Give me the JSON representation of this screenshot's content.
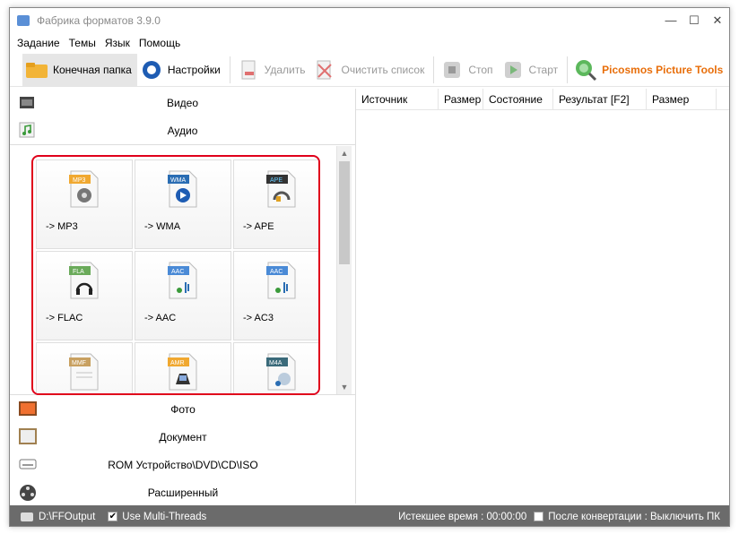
{
  "window": {
    "title": "Фабрика форматов 3.9.0",
    "controls": [
      "—",
      "☐",
      "✕"
    ]
  },
  "menu": [
    "Задание",
    "Темы",
    "Язык",
    "Помощь"
  ],
  "toolbar": {
    "output_folder": "Конечная папка",
    "settings": "Настройки",
    "remove": "Удалить",
    "clear_list": "Очистить список",
    "stop": "Стоп",
    "start": "Старт",
    "picosmos": "Picosmos Picture Tools"
  },
  "categories_top": [
    "Видео",
    "Аудио"
  ],
  "tiles": [
    "-> MP3",
    "-> WMA",
    "-> APE",
    "-> FLAC",
    "-> AAC",
    "-> AC3",
    "",
    "",
    ""
  ],
  "tile_badges": [
    "MP3",
    "WMA",
    "APE",
    "FLA",
    "AAC",
    "AAC",
    "MMF",
    "AMR",
    "M4A"
  ],
  "categories_bottom": [
    "Фото",
    "Документ",
    "ROM Устройство\\DVD\\CD\\ISO",
    "Расширенный"
  ],
  "table_headers": [
    "Источник",
    "Размер",
    "Состояние",
    "Результат [F2]",
    "Размер"
  ],
  "status": {
    "path": "D:\\FFOutput",
    "multithread": "Use Multi-Threads",
    "elapsed": "Истекшее время : 00:00:00",
    "after": "После конвертации : Выключить ПК"
  },
  "colors": {
    "accent_red": "#e0001b",
    "picosmos": "#e86e0a"
  }
}
